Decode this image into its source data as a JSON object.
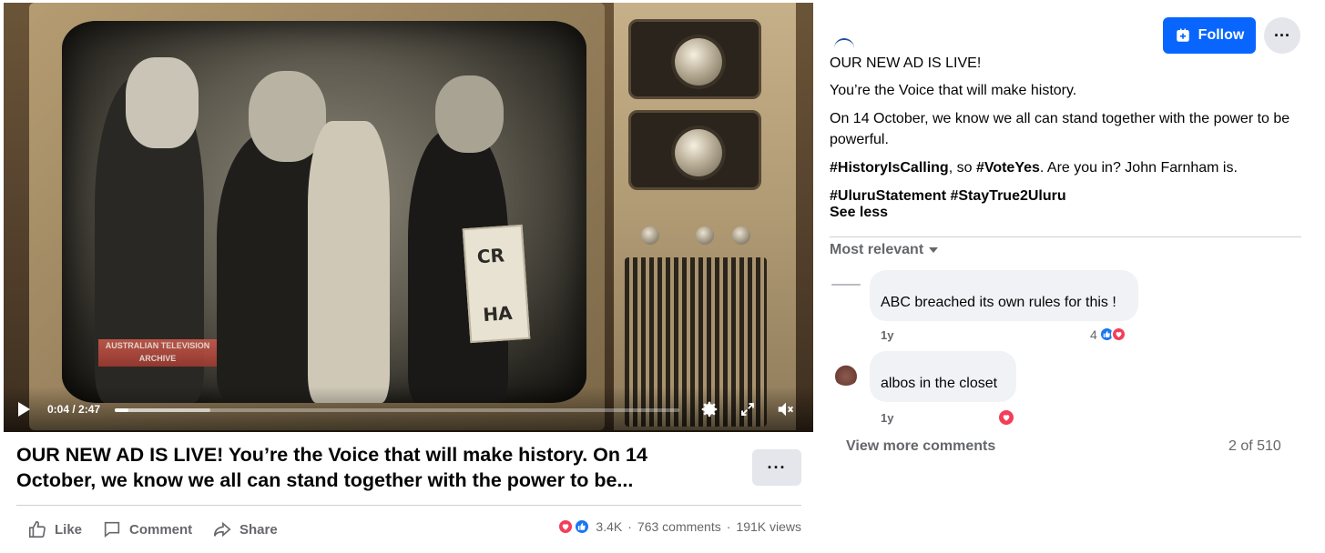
{
  "video": {
    "timecode": "0:04 / 2:47",
    "progress_fraction": 0.024,
    "buffered_fraction": 0.17,
    "archive_label_line1": "AUSTRALIAN TELEVISION",
    "archive_label_line2": "ARCHIVE",
    "sign_line1": "CR",
    "sign_line2": "HA",
    "icons": [
      "play-icon",
      "settings-gear-icon",
      "fullscreen-icon",
      "volume-icon"
    ]
  },
  "post": {
    "title": "OUR NEW AD IS LIVE! You’re the Voice that will make history. On 14 October, we know we all can stand together with the power to be...",
    "more_label": "···"
  },
  "actions": {
    "like": "Like",
    "comment": "Comment",
    "share": "Share"
  },
  "stats": {
    "reactions": "3.4K",
    "comments": "763 comments",
    "separator": "·",
    "views": "191K views"
  },
  "right": {
    "follow_label": "Follow",
    "more_label": "···",
    "caption_line1": "OUR NEW AD IS LIVE!",
    "caption_line2": "You’re the Voice that will make history.",
    "caption_line3": "On 14 October, we know we all can stand together with the power to be powerful.",
    "hashtag1": "#HistoryIsCalling",
    "caption_mid": ", so ",
    "hashtag2": "#VoteYes",
    "caption_end": ". Are you in? John Farnham is.",
    "hashtag3": "#UluruStatement",
    "hashtag4": "#StayTrue2Uluru",
    "see_less": "See less",
    "sort_label": "Most relevant"
  },
  "comments": [
    {
      "text": "ABC breached its own rules for this !",
      "time": "1y",
      "reaction_count": "4"
    },
    {
      "text": "albos in the closet",
      "time": "1y",
      "reaction_count": ""
    }
  ],
  "footer": {
    "view_more": "View more comments",
    "count": "2 of 510"
  },
  "colors": {
    "accent": "#0866ff",
    "like_blue": "#1877f2",
    "love_red": "#f33e58",
    "secondary_text": "#65676b",
    "button_gray": "#e4e6eb"
  }
}
